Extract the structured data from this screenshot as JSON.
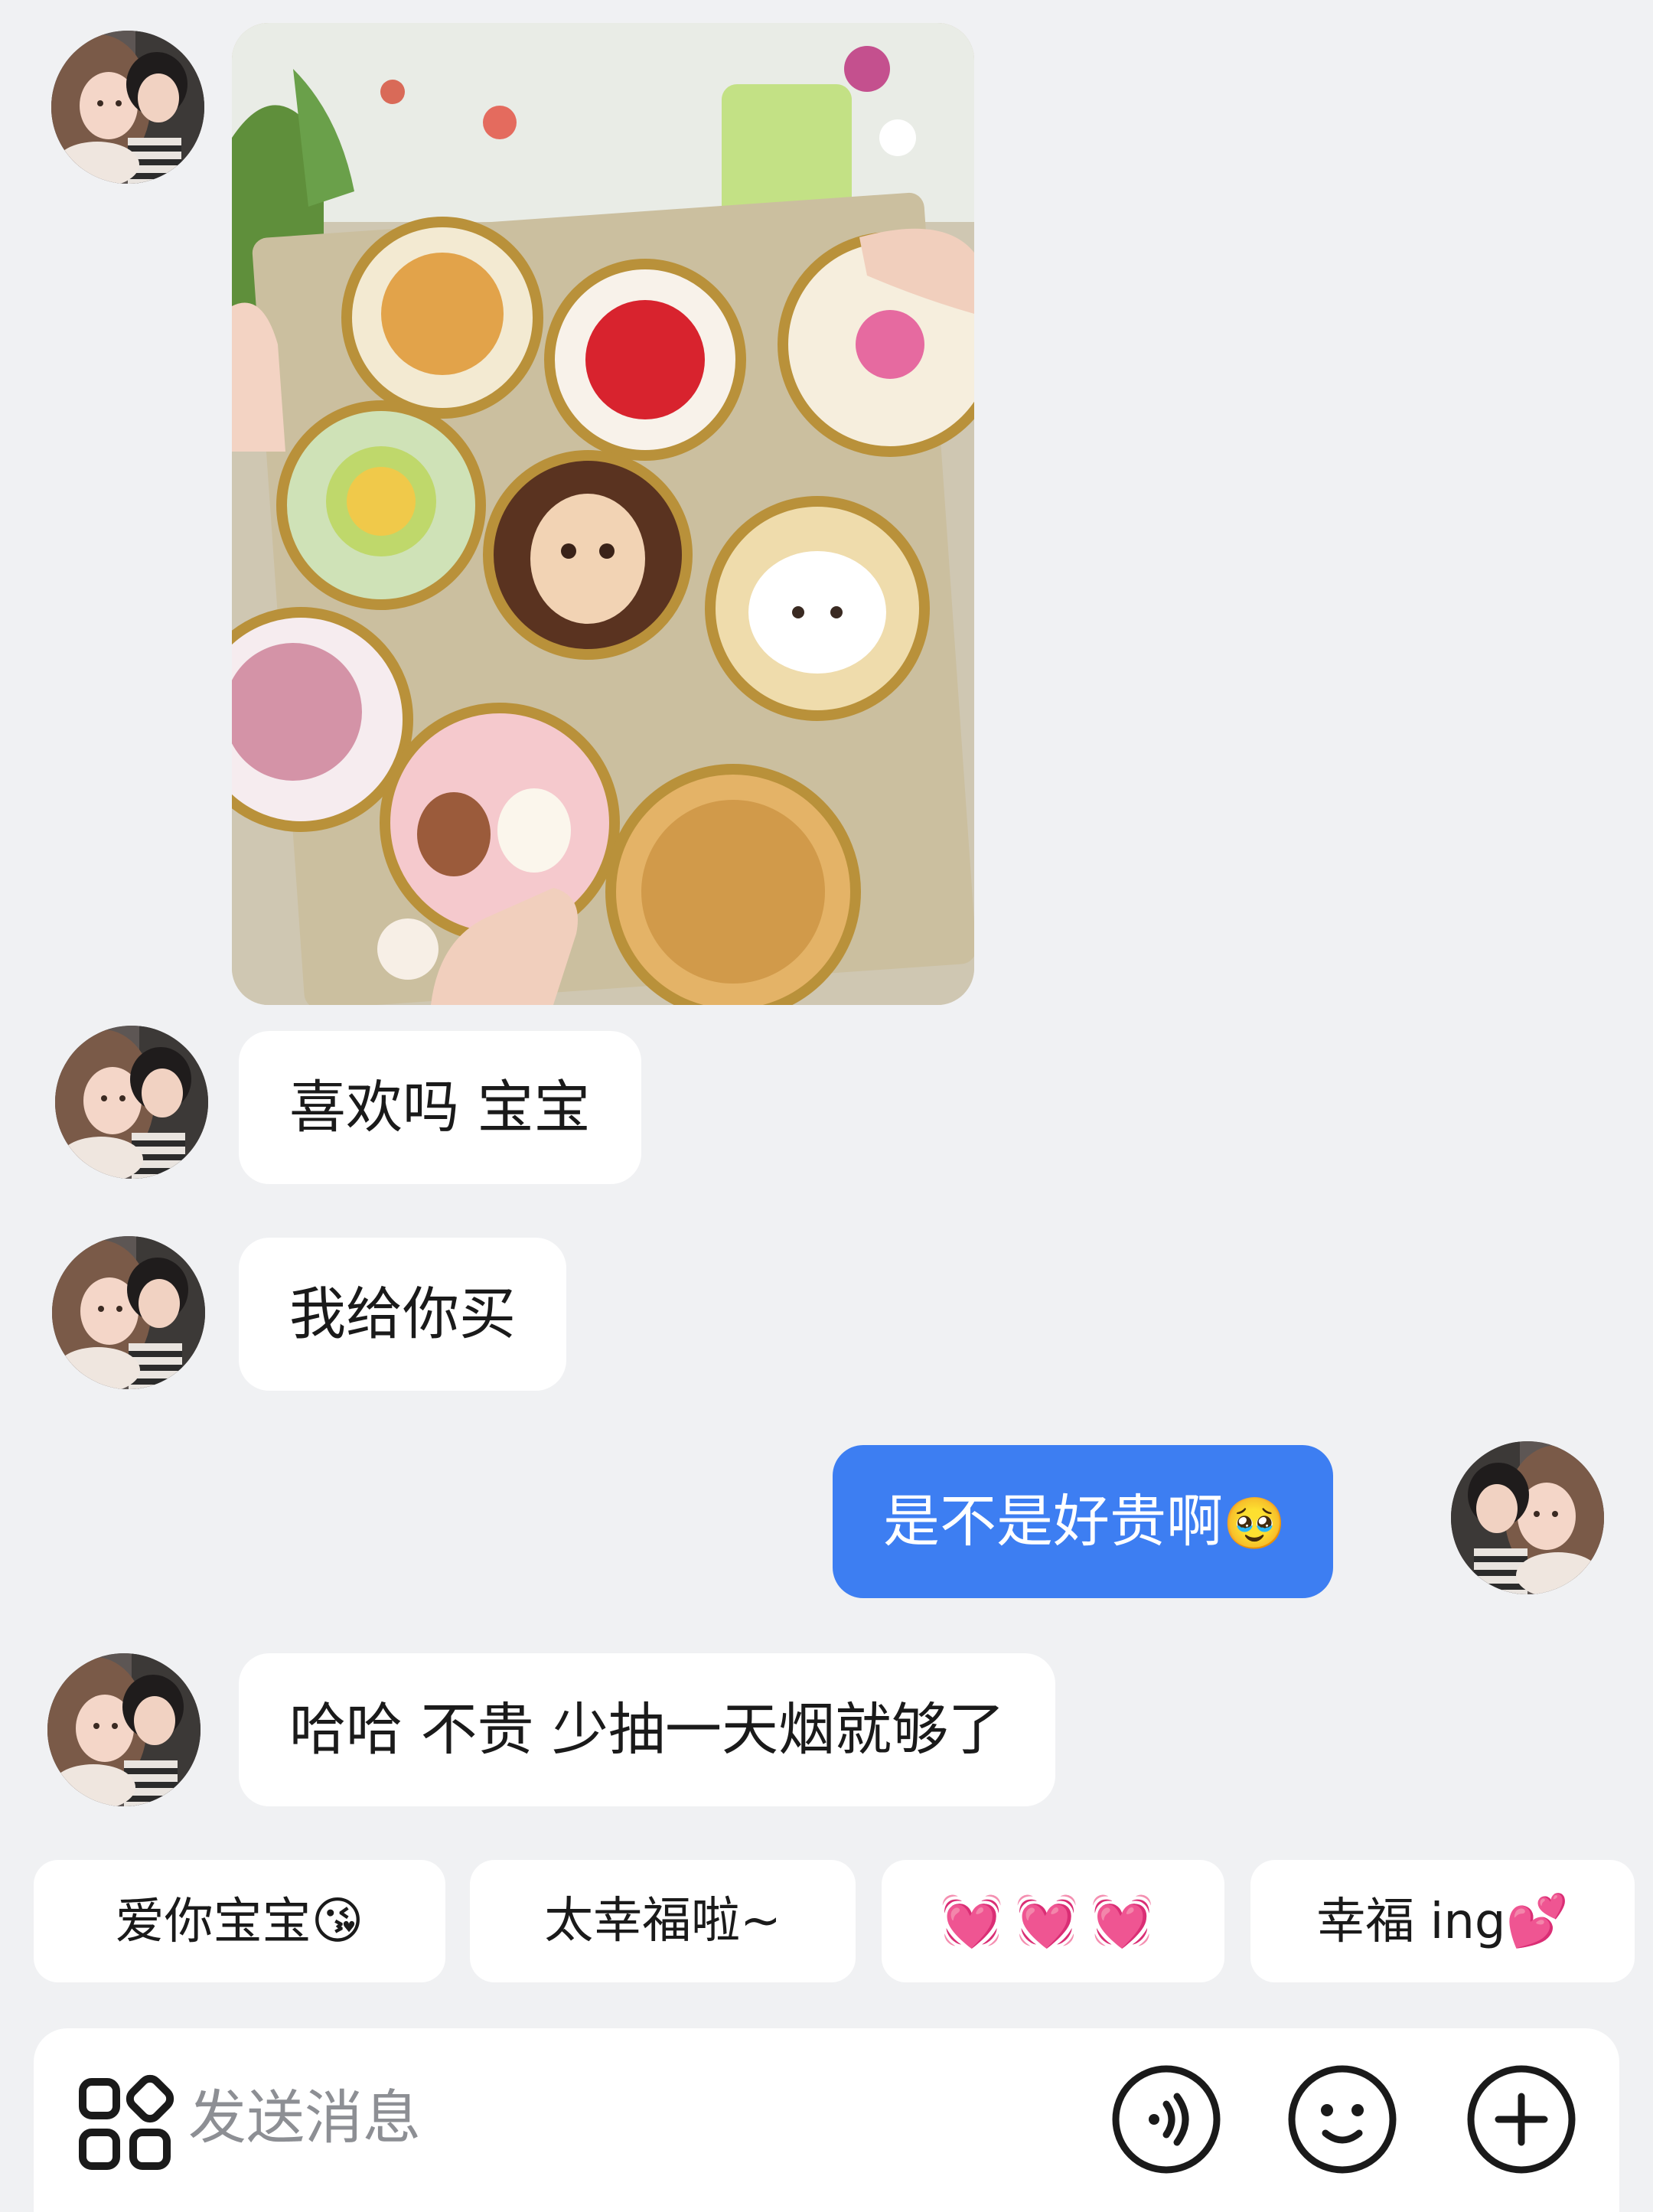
{
  "messages": [
    {
      "sender": "other",
      "type": "image",
      "image_alt": "cakes"
    },
    {
      "sender": "other",
      "type": "text",
      "text": "喜欢吗 宝宝"
    },
    {
      "sender": "other",
      "type": "text",
      "text": "我给你买"
    },
    {
      "sender": "me",
      "type": "text",
      "text": "是不是好贵啊",
      "emoji": "🥹"
    },
    {
      "sender": "other",
      "type": "text",
      "text": "哈哈 不贵 少抽一天烟就够了"
    }
  ],
  "quick_replies": [
    {
      "text": "爱你宝宝",
      "emoji": "😘"
    },
    {
      "text": "太幸福啦~",
      "emoji": ""
    },
    {
      "text": "",
      "emoji": "💓💓💓"
    },
    {
      "text": "幸福 ing",
      "emoji": "💕"
    }
  ],
  "input": {
    "placeholder": "发送消息",
    "icons": [
      "apps-grid-icon",
      "voice-icon",
      "emoji-icon",
      "add-icon"
    ]
  },
  "colors": {
    "background": "#f0f1f3",
    "incoming_bubble": "#ffffff",
    "outgoing_bubble": "#3d7ef2",
    "outgoing_text": "#ffffff",
    "placeholder": "#8d8f94"
  }
}
